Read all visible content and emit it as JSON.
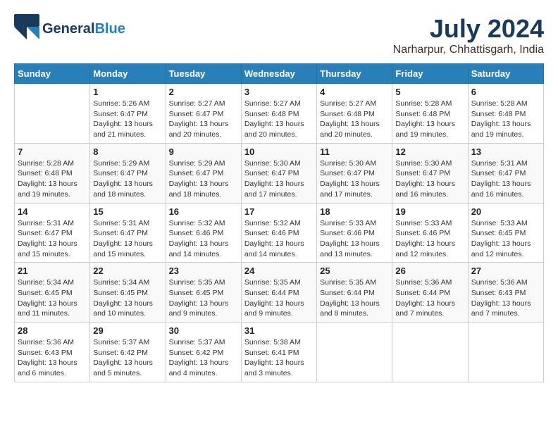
{
  "app": {
    "name": "GeneralBlue",
    "logo_line1": "General",
    "logo_line2": "Blue"
  },
  "calendar": {
    "month": "July 2024",
    "location": "Narharpur, Chhattisgarh, India",
    "days_of_week": [
      "Sunday",
      "Monday",
      "Tuesday",
      "Wednesday",
      "Thursday",
      "Friday",
      "Saturday"
    ],
    "weeks": [
      [
        {
          "day": "",
          "info": ""
        },
        {
          "day": "1",
          "info": "Sunrise: 5:26 AM\nSunset: 6:47 PM\nDaylight: 13 hours\nand 21 minutes."
        },
        {
          "day": "2",
          "info": "Sunrise: 5:27 AM\nSunset: 6:47 PM\nDaylight: 13 hours\nand 20 minutes."
        },
        {
          "day": "3",
          "info": "Sunrise: 5:27 AM\nSunset: 6:48 PM\nDaylight: 13 hours\nand 20 minutes."
        },
        {
          "day": "4",
          "info": "Sunrise: 5:27 AM\nSunset: 6:48 PM\nDaylight: 13 hours\nand 20 minutes."
        },
        {
          "day": "5",
          "info": "Sunrise: 5:28 AM\nSunset: 6:48 PM\nDaylight: 13 hours\nand 19 minutes."
        },
        {
          "day": "6",
          "info": "Sunrise: 5:28 AM\nSunset: 6:48 PM\nDaylight: 13 hours\nand 19 minutes."
        }
      ],
      [
        {
          "day": "7",
          "info": "Sunrise: 5:28 AM\nSunset: 6:48 PM\nDaylight: 13 hours\nand 19 minutes."
        },
        {
          "day": "8",
          "info": "Sunrise: 5:29 AM\nSunset: 6:47 PM\nDaylight: 13 hours\nand 18 minutes."
        },
        {
          "day": "9",
          "info": "Sunrise: 5:29 AM\nSunset: 6:47 PM\nDaylight: 13 hours\nand 18 minutes."
        },
        {
          "day": "10",
          "info": "Sunrise: 5:30 AM\nSunset: 6:47 PM\nDaylight: 13 hours\nand 17 minutes."
        },
        {
          "day": "11",
          "info": "Sunrise: 5:30 AM\nSunset: 6:47 PM\nDaylight: 13 hours\nand 17 minutes."
        },
        {
          "day": "12",
          "info": "Sunrise: 5:30 AM\nSunset: 6:47 PM\nDaylight: 13 hours\nand 16 minutes."
        },
        {
          "day": "13",
          "info": "Sunrise: 5:31 AM\nSunset: 6:47 PM\nDaylight: 13 hours\nand 16 minutes."
        }
      ],
      [
        {
          "day": "14",
          "info": "Sunrise: 5:31 AM\nSunset: 6:47 PM\nDaylight: 13 hours\nand 15 minutes."
        },
        {
          "day": "15",
          "info": "Sunrise: 5:31 AM\nSunset: 6:47 PM\nDaylight: 13 hours\nand 15 minutes."
        },
        {
          "day": "16",
          "info": "Sunrise: 5:32 AM\nSunset: 6:46 PM\nDaylight: 13 hours\nand 14 minutes."
        },
        {
          "day": "17",
          "info": "Sunrise: 5:32 AM\nSunset: 6:46 PM\nDaylight: 13 hours\nand 14 minutes."
        },
        {
          "day": "18",
          "info": "Sunrise: 5:33 AM\nSunset: 6:46 PM\nDaylight: 13 hours\nand 13 minutes."
        },
        {
          "day": "19",
          "info": "Sunrise: 5:33 AM\nSunset: 6:46 PM\nDaylight: 13 hours\nand 12 minutes."
        },
        {
          "day": "20",
          "info": "Sunrise: 5:33 AM\nSunset: 6:45 PM\nDaylight: 13 hours\nand 12 minutes."
        }
      ],
      [
        {
          "day": "21",
          "info": "Sunrise: 5:34 AM\nSunset: 6:45 PM\nDaylight: 13 hours\nand 11 minutes."
        },
        {
          "day": "22",
          "info": "Sunrise: 5:34 AM\nSunset: 6:45 PM\nDaylight: 13 hours\nand 10 minutes."
        },
        {
          "day": "23",
          "info": "Sunrise: 5:35 AM\nSunset: 6:45 PM\nDaylight: 13 hours\nand 9 minutes."
        },
        {
          "day": "24",
          "info": "Sunrise: 5:35 AM\nSunset: 6:44 PM\nDaylight: 13 hours\nand 9 minutes."
        },
        {
          "day": "25",
          "info": "Sunrise: 5:35 AM\nSunset: 6:44 PM\nDaylight: 13 hours\nand 8 minutes."
        },
        {
          "day": "26",
          "info": "Sunrise: 5:36 AM\nSunset: 6:44 PM\nDaylight: 13 hours\nand 7 minutes."
        },
        {
          "day": "27",
          "info": "Sunrise: 5:36 AM\nSunset: 6:43 PM\nDaylight: 13 hours\nand 7 minutes."
        }
      ],
      [
        {
          "day": "28",
          "info": "Sunrise: 5:36 AM\nSunset: 6:43 PM\nDaylight: 13 hours\nand 6 minutes."
        },
        {
          "day": "29",
          "info": "Sunrise: 5:37 AM\nSunset: 6:42 PM\nDaylight: 13 hours\nand 5 minutes."
        },
        {
          "day": "30",
          "info": "Sunrise: 5:37 AM\nSunset: 6:42 PM\nDaylight: 13 hours\nand 4 minutes."
        },
        {
          "day": "31",
          "info": "Sunrise: 5:38 AM\nSunset: 6:41 PM\nDaylight: 13 hours\nand 3 minutes."
        },
        {
          "day": "",
          "info": ""
        },
        {
          "day": "",
          "info": ""
        },
        {
          "day": "",
          "info": ""
        }
      ]
    ]
  }
}
